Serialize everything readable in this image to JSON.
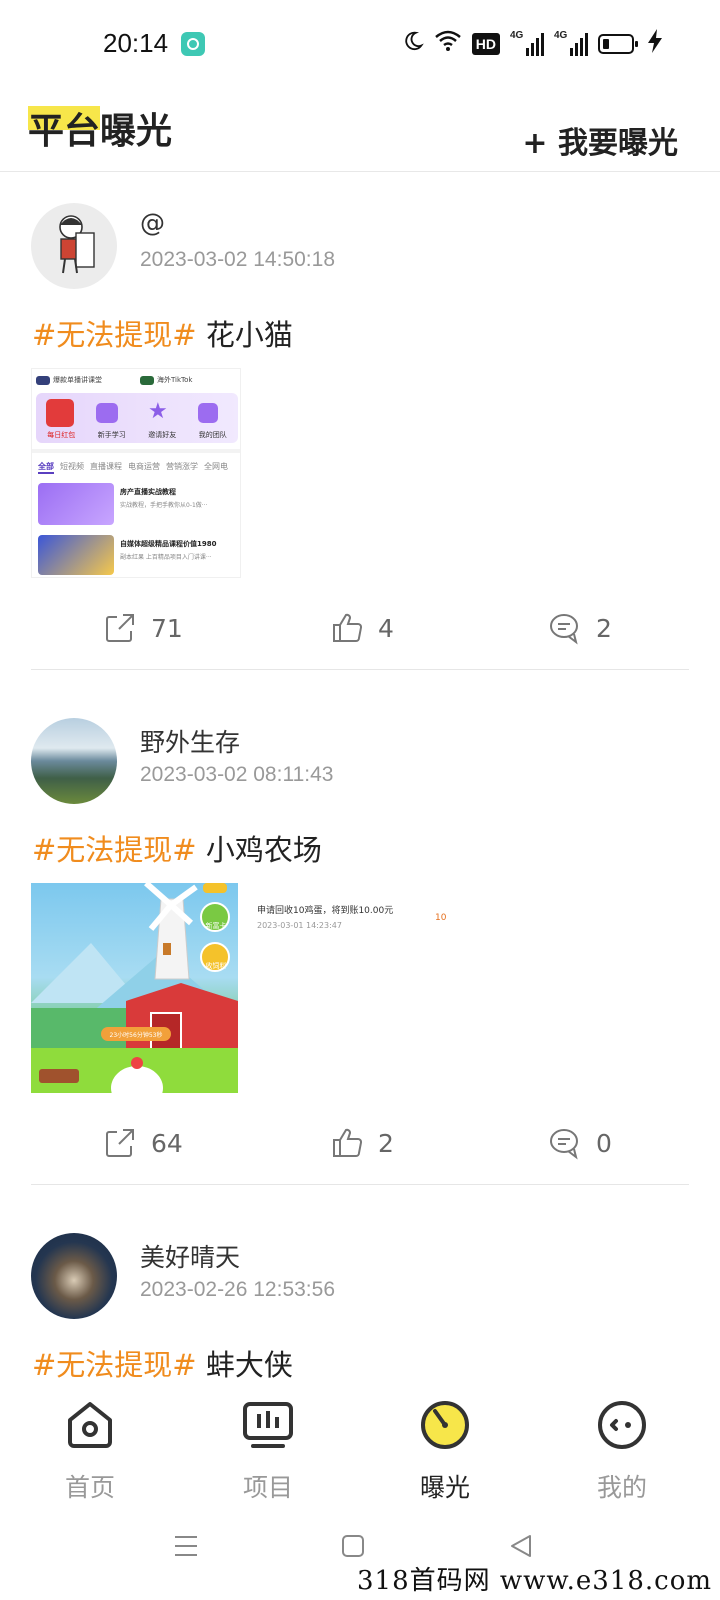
{
  "status_bar": {
    "time": "20:14",
    "hd_label": "HD",
    "net1_label": "4G",
    "net2_label": "4G",
    "icons": [
      "moon-icon",
      "wifi-icon",
      "hd-icon",
      "signal-icon",
      "signal-icon",
      "battery-icon",
      "charging-icon"
    ]
  },
  "header": {
    "title": "平台曝光",
    "action_label": "+ 我要曝光",
    "highlight_color": "#f7e64a"
  },
  "posts": [
    {
      "username": "@",
      "timestamp": "2023-03-02 14:50:18",
      "tag": "#无法提现#",
      "subject": " 花小猫",
      "image": {
        "tab1": "爆款单播讲课堂",
        "tab2": "海外TikTok",
        "menu": [
          "每日红包",
          "新手学习",
          "邀请好友",
          "我的团队"
        ],
        "categories": [
          "全部",
          "短视频",
          "直播课程",
          "电商运营",
          "营销涨学",
          "全网电"
        ],
        "course1_title": "房产直播实战教程",
        "course1_desc": "实战教程，手把手教你从0-1做···",
        "course2_title": "自媒体超级精品课程价值1980",
        "course2_desc": "副本红果 上百精品项目入门讲课···"
      },
      "shares": "71",
      "likes": "4",
      "comments": "2"
    },
    {
      "username": "野外生存",
      "timestamp": "2023-03-02 08:11:43",
      "tag": "#无法提现#",
      "subject": " 小鸡农场",
      "image": {
        "timer": "23小时56分钟53秒",
        "side1": "新富卡",
        "side2": "收饲料",
        "record_text": "申请回收10鸡蛋，将到账10.00元",
        "record_time": "2023-03-01 14:23:47",
        "record_amount": "10"
      },
      "shares": "64",
      "likes": "2",
      "comments": "0"
    },
    {
      "username": "美好晴天",
      "timestamp": "2023-02-26 12:53:56",
      "tag": "#无法提现#",
      "subject": " 蚌大侠"
    }
  ],
  "tab_bar": {
    "tabs": [
      {
        "label": "首页",
        "icon": "home-icon"
      },
      {
        "label": "项目",
        "icon": "projects-icon"
      },
      {
        "label": "曝光",
        "icon": "expose-icon"
      },
      {
        "label": "我的",
        "icon": "profile-icon"
      }
    ],
    "active": "曝光",
    "accent": "#f7e64a"
  },
  "nav_bar": {
    "icons": [
      "menu-icon",
      "home-square-icon",
      "back-icon"
    ]
  },
  "watermark": "318首码网 www.e318.com"
}
